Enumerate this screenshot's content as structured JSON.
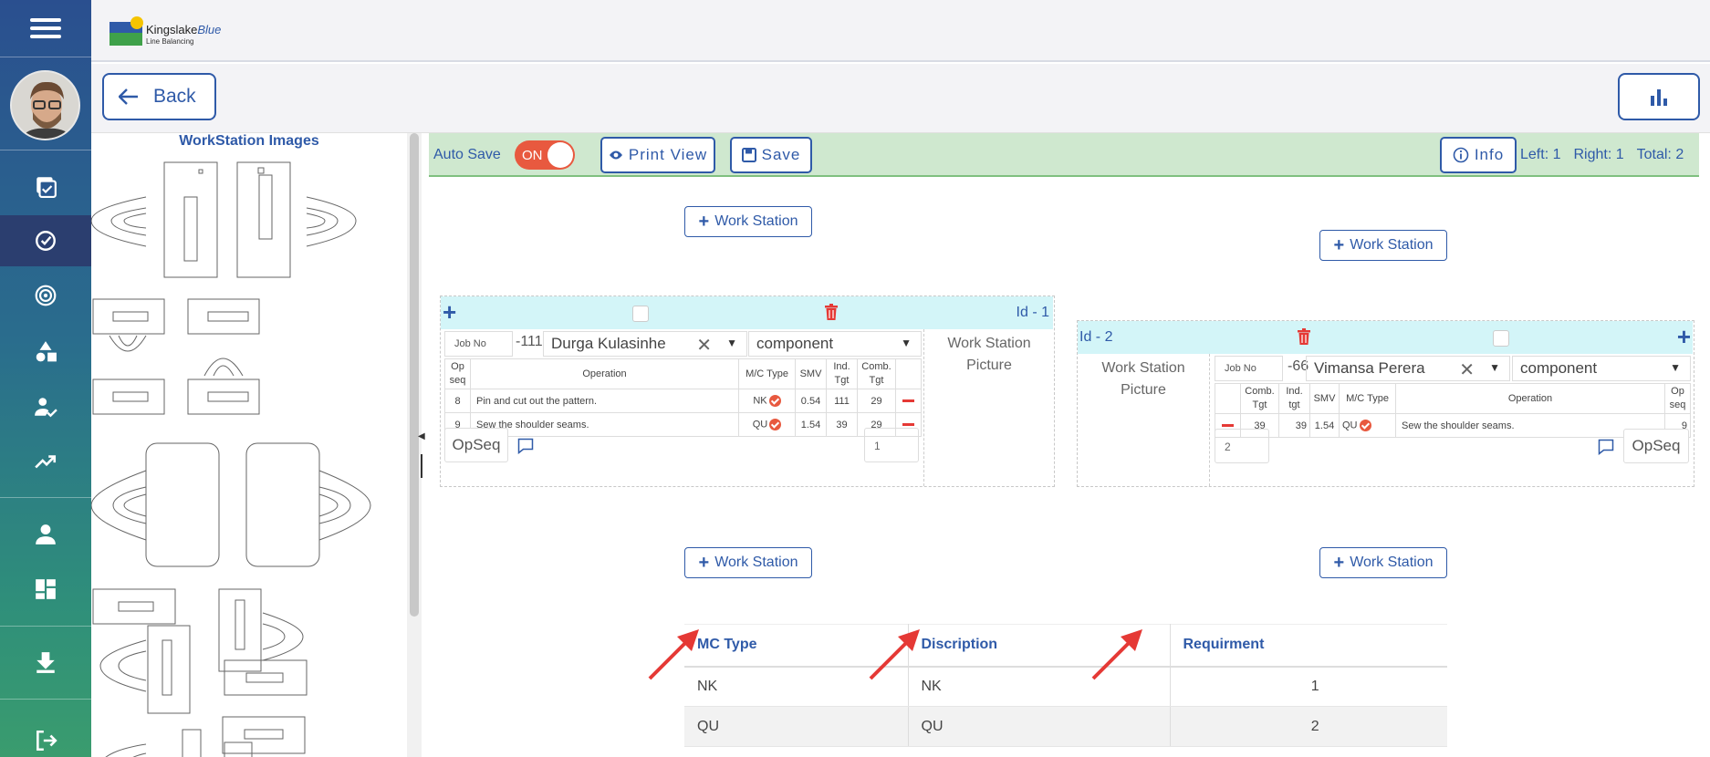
{
  "app": {
    "logo_name": "Kingslake",
    "logo_name_accent": "Blue",
    "logo_sub": "Line Balancing"
  },
  "nav": {
    "back_label": "Back"
  },
  "sidebar": {
    "items": [
      {
        "icon": "clipboard-check-icon"
      },
      {
        "icon": "check-circle-icon",
        "active": true
      },
      {
        "icon": "target-icon"
      },
      {
        "icon": "shapes-icon"
      },
      {
        "icon": "user-check-icon"
      },
      {
        "icon": "trending-up-icon"
      },
      {
        "icon": "user-icon"
      },
      {
        "icon": "dashboard-icon"
      },
      {
        "icon": "download-icon"
      },
      {
        "icon": "logout-icon"
      }
    ]
  },
  "left_panel": {
    "title": "WorkStation Images"
  },
  "toolbar": {
    "auto_save_label": "Auto Save",
    "toggle_label": "ON",
    "print_label": "Print View",
    "save_label": "Save",
    "info_label": "Info",
    "left_count": "Left: 1",
    "right_count": "Right: 1",
    "total_count": "Total: 2"
  },
  "add_ws_label": "Work Station",
  "workstations": [
    {
      "id_label": "Id - 1",
      "job_placeholder": "Job No",
      "job_suffix": "-111",
      "operator": "Durga Kulasinhe",
      "component": "component",
      "picture_label": [
        "Work Station",
        "Picture"
      ],
      "headers": [
        "Op seq",
        "Operation",
        "M/C Type",
        "SMV",
        "Ind. Tgt",
        "Comb. Tgt"
      ],
      "rows": [
        {
          "seq": "8",
          "operation": "Pin and cut out the pattern.",
          "mc": "NK",
          "smv": "0.54",
          "ind": "111",
          "comb": "29"
        },
        {
          "seq": "9",
          "operation": "Sew the shoulder seams.",
          "mc": "QU",
          "smv": "1.54",
          "ind": "39",
          "comb": "29"
        }
      ],
      "opseq_label": "OpSeq",
      "count_value": "1"
    },
    {
      "id_label": "Id - 2",
      "job_placeholder": "Job No",
      "job_suffix": "-66",
      "operator": "Vimansa Perera",
      "component": "component",
      "picture_label": [
        "Work Station",
        "Picture"
      ],
      "headers": [
        "Comb. Tgt",
        "Ind. tgt",
        "SMV",
        "M/C Type",
        "Operation",
        "Op seq"
      ],
      "rows": [
        {
          "comb": "39",
          "ind": "39",
          "smv": "1.54",
          "mc": "QU",
          "operation": "Sew the shoulder seams.",
          "seq": "9"
        }
      ],
      "opseq_label": "OpSeq",
      "count_value": "2"
    }
  ],
  "mc_table": {
    "headers": [
      "MC Type",
      "Discription",
      "Requirment"
    ],
    "rows": [
      [
        "NK",
        "NK",
        "1"
      ],
      [
        "QU",
        "QU",
        "2"
      ]
    ]
  },
  "colors": {
    "accent": "#2f5aa8",
    "toggle": "#e8593f",
    "delete": "#e53935",
    "arrow": "#e53935",
    "toolbar_bg": "#cfe8cf",
    "card_head": "#d3f5f8"
  }
}
